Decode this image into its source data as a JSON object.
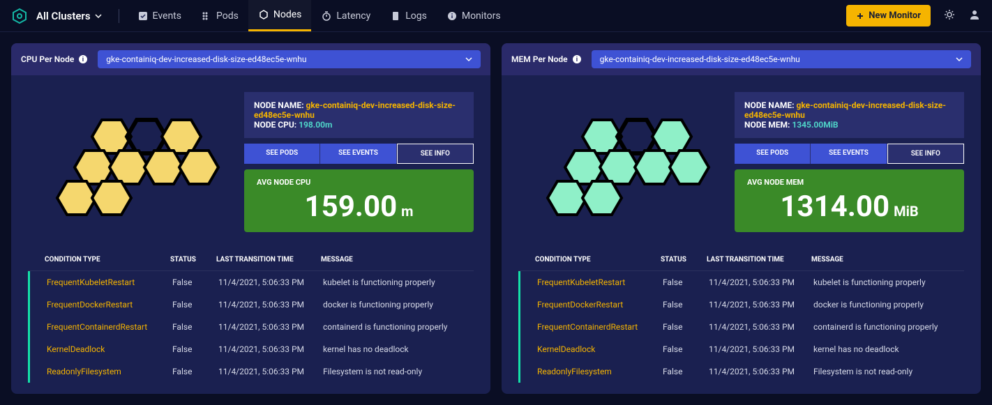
{
  "topbar": {
    "cluster_label": "All Clusters",
    "nav": {
      "events": "Events",
      "pods": "Pods",
      "nodes": "Nodes",
      "latency": "Latency",
      "logs": "Logs",
      "monitors": "Monitors"
    },
    "new_monitor_label": "New Monitor"
  },
  "panels": {
    "cpu": {
      "panel_title": "CPU Per Node",
      "selected_node": "gke-containiq-dev-increased-disk-size-ed48ec5e-wnhu",
      "node_name_label": "NODE NAME:",
      "node_name_value": "gke-containiq-dev-increased-disk-size-ed48ec5e-wnhu",
      "metric_label": "NODE CPU:",
      "metric_value": "198.00m",
      "see_pods": "SEE PODS",
      "see_events": "SEE EVENTS",
      "see_info": "SEE INFO",
      "avg_label": "AVG NODE CPU",
      "avg_value": "159.00",
      "avg_unit": "m",
      "hex_fill": "#f5d76e",
      "table": {
        "h_cond": "CONDITION TYPE",
        "h_stat": "STATUS",
        "h_time": "LAST TRANSITION TIME",
        "h_msg": "MESSAGE",
        "rows": [
          {
            "cond": "FrequentKubeletRestart",
            "stat": "False",
            "time": "11/4/2021, 5:06:33 PM",
            "msg": "kubelet is functioning properly"
          },
          {
            "cond": "FrequentDockerRestart",
            "stat": "False",
            "time": "11/4/2021, 5:06:33 PM",
            "msg": "docker is functioning properly"
          },
          {
            "cond": "FrequentContainerdRestart",
            "stat": "False",
            "time": "11/4/2021, 5:06:33 PM",
            "msg": "containerd is functioning properly"
          },
          {
            "cond": "KernelDeadlock",
            "stat": "False",
            "time": "11/4/2021, 5:06:33 PM",
            "msg": "kernel has no deadlock"
          },
          {
            "cond": "ReadonlyFilesystem",
            "stat": "False",
            "time": "11/4/2021, 5:06:33 PM",
            "msg": "Filesystem is not read-only"
          }
        ]
      }
    },
    "mem": {
      "panel_title": "MEM Per Node",
      "selected_node": "gke-containiq-dev-increased-disk-size-ed48ec5e-wnhu",
      "node_name_label": "NODE NAME:",
      "node_name_value": "gke-containiq-dev-increased-disk-size-ed48ec5e-wnhu",
      "metric_label": "NODE MEM:",
      "metric_value": "1345.00MiB",
      "see_pods": "SEE PODS",
      "see_events": "SEE EVENTS",
      "see_info": "SEE INFO",
      "avg_label": "AVG NODE MEM",
      "avg_value": "1314.00",
      "avg_unit": "MiB",
      "hex_fill": "#8ff0c8",
      "table": {
        "h_cond": "CONDITION TYPE",
        "h_stat": "STATUS",
        "h_time": "LAST TRANSITION TIME",
        "h_msg": "MESSAGE",
        "rows": [
          {
            "cond": "FrequentKubeletRestart",
            "stat": "False",
            "time": "11/4/2021, 5:06:33 PM",
            "msg": "kubelet is functioning properly"
          },
          {
            "cond": "FrequentDockerRestart",
            "stat": "False",
            "time": "11/4/2021, 5:06:33 PM",
            "msg": "docker is functioning properly"
          },
          {
            "cond": "FrequentContainerdRestart",
            "stat": "False",
            "time": "11/4/2021, 5:06:33 PM",
            "msg": "containerd is functioning properly"
          },
          {
            "cond": "KernelDeadlock",
            "stat": "False",
            "time": "11/4/2021, 5:06:33 PM",
            "msg": "kernel has no deadlock"
          },
          {
            "cond": "ReadonlyFilesystem",
            "stat": "False",
            "time": "11/4/2021, 5:06:33 PM",
            "msg": "Filesystem is not read-only"
          }
        ]
      }
    }
  }
}
